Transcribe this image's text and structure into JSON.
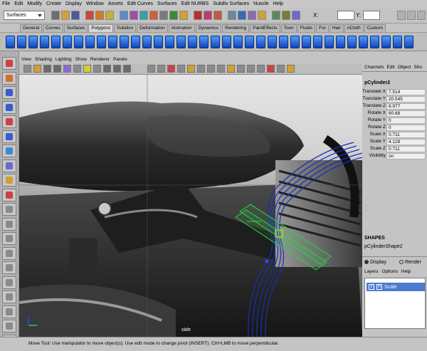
{
  "menubar": [
    "File",
    "Edit",
    "Modify",
    "Create",
    "Display",
    "Window",
    "Assets",
    "Edit Curves",
    "Surfaces",
    "Edit NURBS",
    "Subdiv Surfaces",
    "Nuscle",
    "Help"
  ],
  "status": {
    "mode": "Surfaces",
    "x_label": "X:",
    "y_label": "Y:"
  },
  "shelf_tabs": [
    "General",
    "Curves",
    "Surfaces",
    "Polygons",
    "Subdivs",
    "Deformation",
    "Animation",
    "Dynamics",
    "Rendering",
    "PaintEffects",
    "Toon",
    "Fluids",
    "Fur",
    "Hair",
    "nCloth",
    "Custom"
  ],
  "shelf_active": "Polygons",
  "panel_menu": [
    "View",
    "Shading",
    "Lighting",
    "Show",
    "Renderer",
    "Panels"
  ],
  "viewport": {
    "camera_label": "side"
  },
  "channel_menu": [
    "Channels",
    "Edit",
    "Object",
    "Sho"
  ],
  "channel_box": {
    "object": "pCylinder2",
    "attributes": [
      {
        "name": "Translate X",
        "value": "7.514"
      },
      {
        "name": "Translate Y",
        "value": "20.545"
      },
      {
        "name": "Translate Z",
        "value": "8.977"
      },
      {
        "name": "Rotate X",
        "value": "60.68"
      },
      {
        "name": "Rotate Y",
        "value": "0"
      },
      {
        "name": "Rotate Z",
        "value": "0"
      },
      {
        "name": "Scale X",
        "value": "0.711"
      },
      {
        "name": "Scale Y",
        "value": "4.128"
      },
      {
        "name": "Scale Z",
        "value": "0.711"
      },
      {
        "name": "Visibility",
        "value": "on"
      }
    ],
    "shapes_header": "SHAPES",
    "shape_name": "pCylinderShape2"
  },
  "layer_editor": {
    "display": "Display",
    "render": "Render",
    "menu": [
      "Layers",
      "Options",
      "Help"
    ],
    "layer": {
      "v": "V",
      "r": "R",
      "name": "Scale"
    }
  },
  "help_line": "Move Tool: Use manipulator to move object(s). Use edit mode to change pivot (INSERT). Ctrl+LMB to move perpendicular.",
  "colors": {
    "shelf_icon": "#2f6fe0",
    "wire": "#1a2fb0",
    "manip": "#2fd04a",
    "layer_sel": "#4a7bd1"
  }
}
